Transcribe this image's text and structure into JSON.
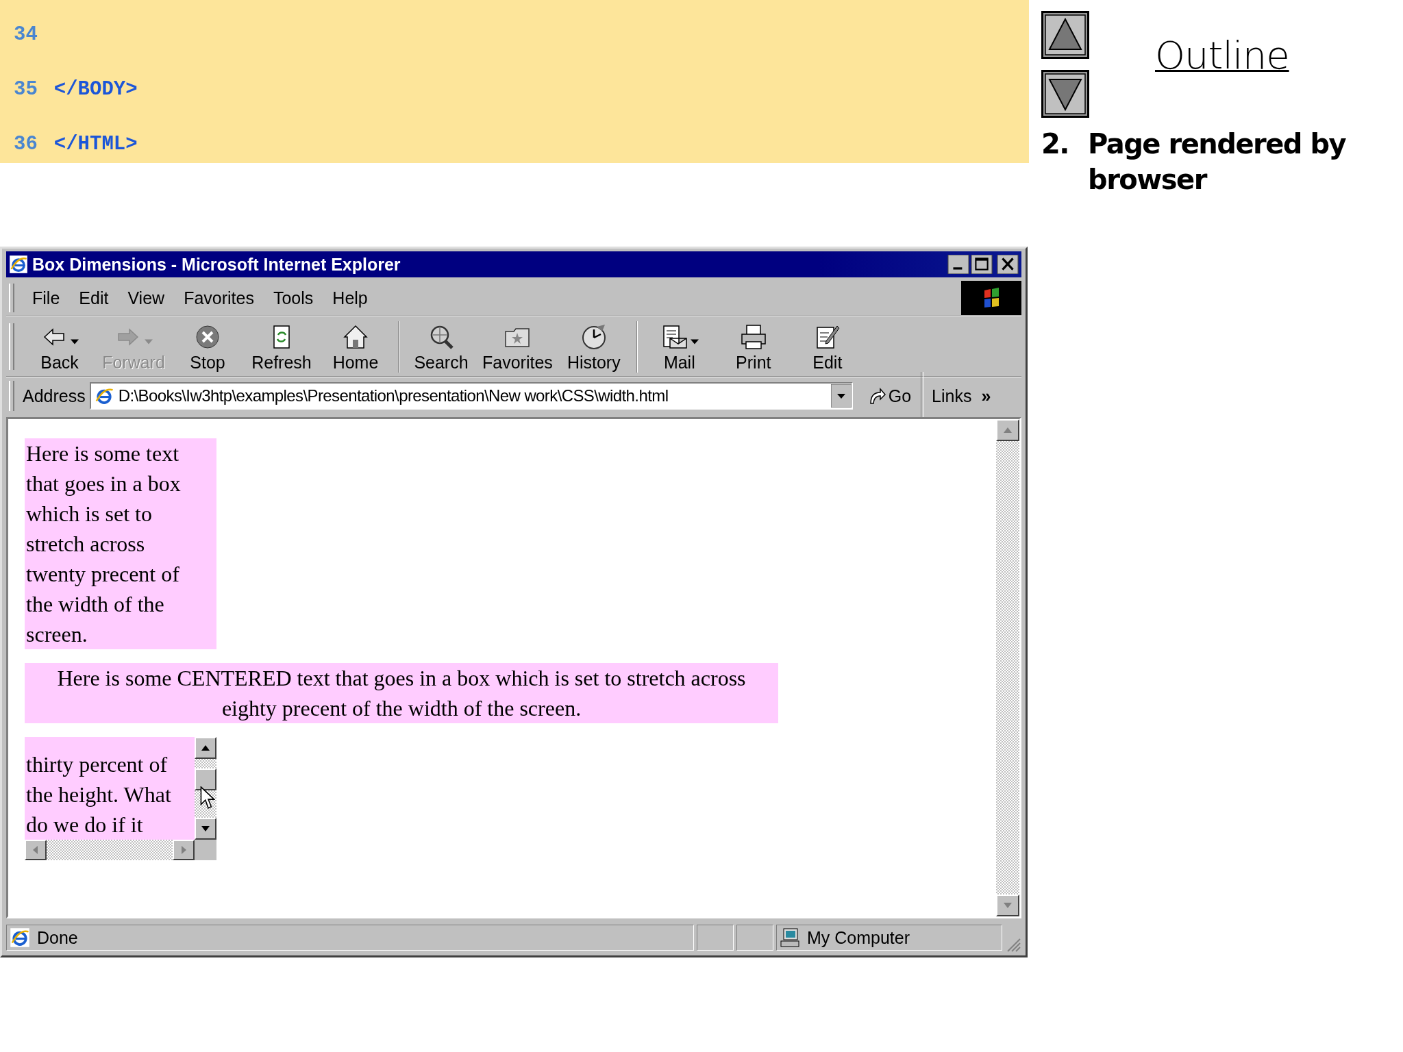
{
  "code_listing": {
    "lines": [
      {
        "number": "34"
      },
      {
        "number": "35",
        "code": "</BODY>"
      },
      {
        "number": "36",
        "code": "</HTML>"
      }
    ]
  },
  "outline": {
    "title": "Outline",
    "steps": [
      {
        "number": "2.",
        "text": "Page rendered by browser"
      }
    ]
  },
  "browser": {
    "title": "Box Dimensions - Microsoft Internet Explorer",
    "menu": [
      "File",
      "Edit",
      "View",
      "Favorites",
      "Tools",
      "Help"
    ],
    "toolbar": [
      {
        "kind": "back",
        "label": "Back",
        "disabled": false,
        "dropdown": true,
        "separator_before": false
      },
      {
        "kind": "forward",
        "label": "Forward",
        "disabled": true,
        "dropdown": true,
        "separator_before": false
      },
      {
        "kind": "stop",
        "label": "Stop",
        "disabled": false,
        "dropdown": false,
        "separator_before": false
      },
      {
        "kind": "refresh",
        "label": "Refresh",
        "disabled": false,
        "dropdown": false,
        "separator_before": false
      },
      {
        "kind": "home",
        "label": "Home",
        "disabled": false,
        "dropdown": false,
        "separator_before": false
      },
      {
        "kind": "search",
        "label": "Search",
        "disabled": false,
        "dropdown": false,
        "separator_before": true
      },
      {
        "kind": "favorites",
        "label": "Favorites",
        "disabled": false,
        "dropdown": false,
        "separator_before": false
      },
      {
        "kind": "history",
        "label": "History",
        "disabled": false,
        "dropdown": false,
        "separator_before": false
      },
      {
        "kind": "mail",
        "label": "Mail",
        "disabled": false,
        "dropdown": true,
        "separator_before": true
      },
      {
        "kind": "print",
        "label": "Print",
        "disabled": false,
        "dropdown": false,
        "separator_before": false
      },
      {
        "kind": "edit",
        "label": "Edit",
        "disabled": false,
        "dropdown": false,
        "separator_before": false
      }
    ],
    "address": {
      "label": "Address",
      "value": "D:\\Books\\Iw3htp\\examples\\Presentation\\presentation\\New work\\CSS\\width.html",
      "go": "Go",
      "links": "Links",
      "more": "»"
    },
    "content": {
      "boxes": [
        {
          "kind": "narrow",
          "text": "Here is some text that goes in a box which is set to stretch across twenty precent of the width of the screen."
        },
        {
          "kind": "centered",
          "text": "Here is some CENTERED text that goes in a box which is set to stretch across eighty precent of the width of the screen."
        },
        {
          "kind": "scrolling",
          "text": "thirty percent of the height. What do we do if it"
        }
      ]
    },
    "status_bar": {
      "text": "Done",
      "zone": "My Computer"
    }
  }
}
